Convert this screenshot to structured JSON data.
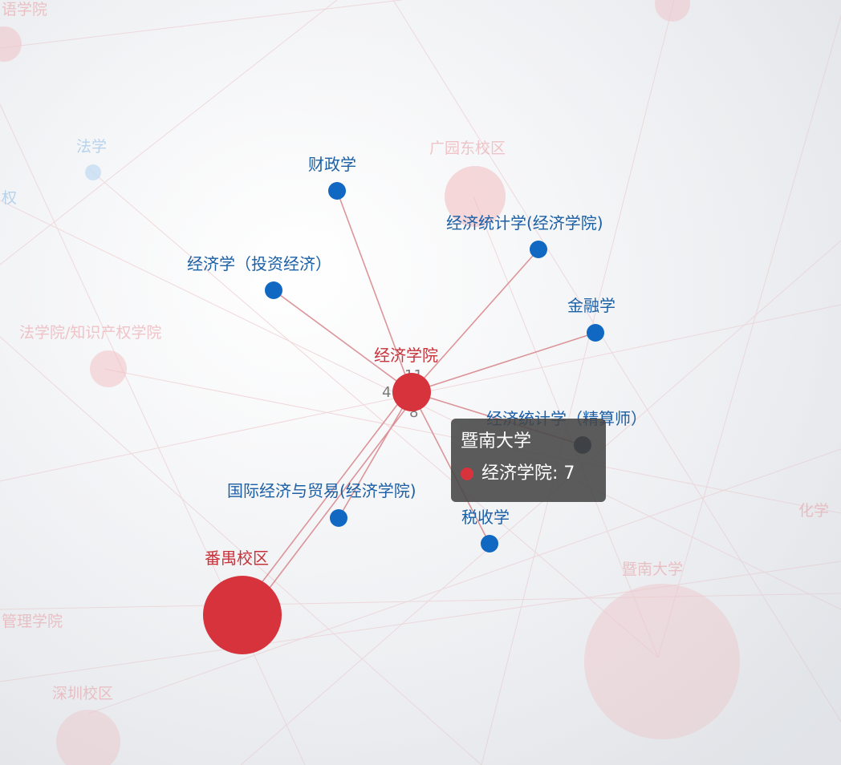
{
  "colors": {
    "red": "#d7333d",
    "blue": "#1068c2",
    "dark_blue": "#0e2a52",
    "edge": "#d98a8f",
    "faded_red": "#f0b3b7",
    "faded_blue": "#bcd9f3"
  },
  "graph": {
    "nodes": [
      {
        "id": "econ_school",
        "label": "经济学院",
        "group": "school",
        "style": "focus-red"
      },
      {
        "id": "panyu",
        "label": "番禺校区",
        "group": "campus",
        "style": "focus-red"
      },
      {
        "id": "caizheng",
        "label": "财政学",
        "group": "major",
        "style": "focus-blue"
      },
      {
        "id": "tongji_econ",
        "label": "经济统计学(经济学院)",
        "group": "major",
        "style": "focus-blue"
      },
      {
        "id": "touzi",
        "label": "经济学（投资经济）",
        "group": "major",
        "style": "focus-blue"
      },
      {
        "id": "jinrong",
        "label": "金融学",
        "group": "major",
        "style": "focus-blue"
      },
      {
        "id": "tongji_actuary",
        "label": "经济统计学（精算师）",
        "group": "major",
        "style": "focus-blue"
      },
      {
        "id": "guoji",
        "label": "国际经济与贸易(经济学院)",
        "group": "major",
        "style": "focus-blue"
      },
      {
        "id": "shuishou",
        "label": "税收学",
        "group": "major",
        "style": "focus-blue"
      },
      {
        "id": "law",
        "label": "法学",
        "group": "major",
        "style": "faded-blue"
      },
      {
        "id": "quan",
        "label": "权",
        "group": "major",
        "style": "faded-blue"
      },
      {
        "id": "gd_east",
        "label": "广园东校区",
        "group": "campus",
        "style": "faded"
      },
      {
        "id": "law_school",
        "label": "法学院/知识产权学院",
        "group": "school",
        "style": "faded"
      },
      {
        "id": "mgmt",
        "label": "管理学院",
        "group": "school",
        "style": "faded"
      },
      {
        "id": "shenzhen",
        "label": "深圳校区",
        "group": "campus",
        "style": "faded"
      },
      {
        "id": "jinan",
        "label": "暨南大学",
        "group": "university",
        "style": "faded"
      },
      {
        "id": "chem",
        "label": "化学",
        "group": "major",
        "style": "faded"
      },
      {
        "id": "top_left",
        "label": "语学院",
        "group": "school",
        "style": "faded"
      }
    ],
    "edges": [
      {
        "from": "econ_school",
        "to": "caizheng"
      },
      {
        "from": "econ_school",
        "to": "tongji_econ"
      },
      {
        "from": "econ_school",
        "to": "touzi"
      },
      {
        "from": "econ_school",
        "to": "jinrong"
      },
      {
        "from": "econ_school",
        "to": "tongji_actuary"
      },
      {
        "from": "econ_school",
        "to": "guoji"
      },
      {
        "from": "econ_school",
        "to": "shuishou"
      },
      {
        "from": "econ_school",
        "to": "panyu"
      }
    ],
    "edge_labels": [
      "11",
      "4",
      "8"
    ]
  },
  "tooltip": {
    "title": "暨南大学",
    "entry_label": "经济学院: 7",
    "entry_color": "#d7333d"
  }
}
